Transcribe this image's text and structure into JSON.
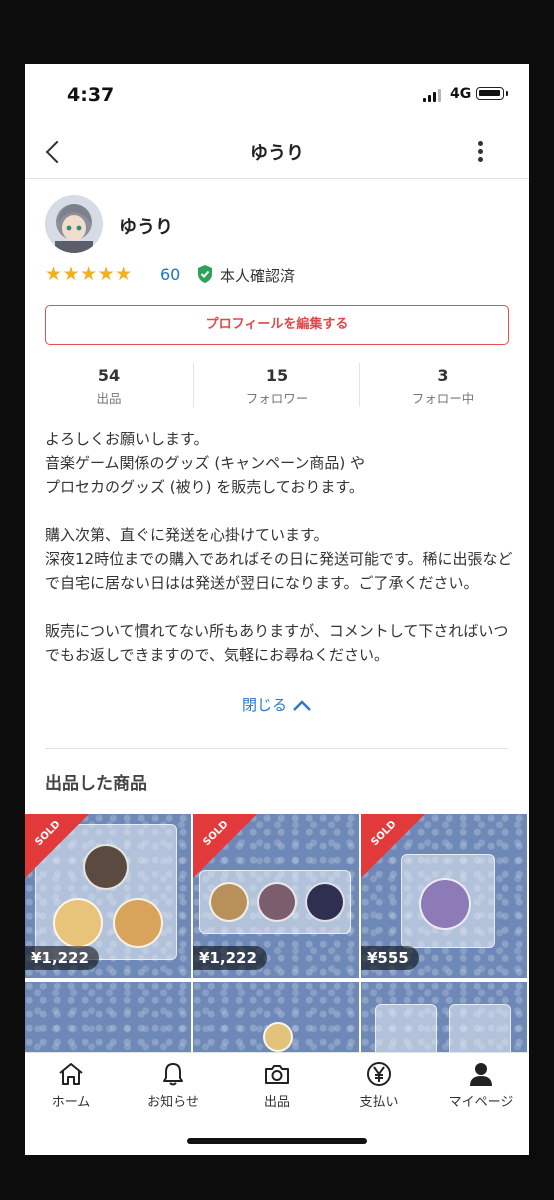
{
  "status_bar": {
    "time": "4:37",
    "network": "4G"
  },
  "nav": {
    "title": "ゆうり"
  },
  "profile": {
    "name": "ゆうり",
    "stars": "★★★★★",
    "rating": 5,
    "rating_count": "60",
    "verified_label": "本人確認済",
    "edit_button": "プロフィールを編集する"
  },
  "stats": [
    {
      "value": "54",
      "label": "出品"
    },
    {
      "value": "15",
      "label": "フォロワー"
    },
    {
      "value": "3",
      "label": "フォロー中"
    }
  ],
  "bio": {
    "lines": [
      "よろしくお願いします。",
      "音楽ゲーム関係のグッズ (キャンペーン商品) や",
      "プロセカのグッズ (被り) を販売しております。",
      "",
      "購入次第、直ぐに発送を心掛けています。",
      "深夜12時位までの購入であればその日に発送可能です。稀に出張などで自宅に居ない日はは発送が翌日になります。ご了承ください。",
      "",
      "販売について慣れてない所もありますが、コメントして下さればいつでもお返しできますので、気軽にお尋ねください。"
    ],
    "close_label": "閉じる"
  },
  "listings": {
    "title": "出品した商品",
    "items": [
      {
        "sold_label": "SOLD",
        "price": "¥1,222"
      },
      {
        "sold_label": "SOLD",
        "price": "¥1,222"
      },
      {
        "sold_label": "SOLD",
        "price": "¥555"
      }
    ]
  },
  "tabbar": [
    {
      "label": "ホーム",
      "icon": "home-icon"
    },
    {
      "label": "お知らせ",
      "icon": "bell-icon"
    },
    {
      "label": "出品",
      "icon": "camera-icon"
    },
    {
      "label": "支払い",
      "icon": "yen-icon"
    },
    {
      "label": "マイページ",
      "icon": "person-icon"
    }
  ],
  "colors": {
    "accent": "#e04848",
    "link": "#2a78c8",
    "star": "#f2b01e",
    "verified": "#2fa15b",
    "sold": "#e23a3a"
  }
}
